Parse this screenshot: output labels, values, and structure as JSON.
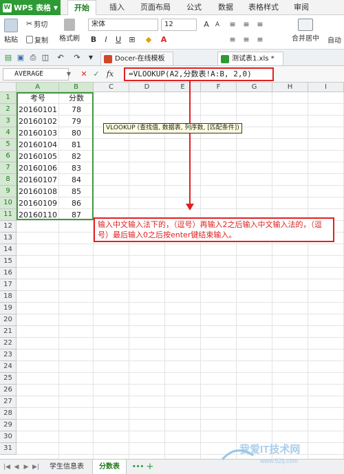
{
  "topbar": {
    "app_name": "WPS 表格",
    "tabs": [
      "开始",
      "插入",
      "页面布局",
      "公式",
      "数据",
      "表格样式",
      "审阅"
    ]
  },
  "ribbon": {
    "paste": "粘贴",
    "cut": "剪切",
    "copy": "复制",
    "format_painter": "格式刷",
    "font_name": "宋体",
    "font_size": "12",
    "merge_center": "合并居中",
    "wrap": "自动"
  },
  "doc_tabs": [
    {
      "label": "Docer-在线模板"
    },
    {
      "label": "测试表1.xls *"
    }
  ],
  "formula_bar": {
    "name_box": "AVERAGE",
    "fx": "fx",
    "formula": "=VLOOKUP(A2,分数表!A:B, 2,0)"
  },
  "grid": {
    "columns": [
      "A",
      "B",
      "C",
      "D",
      "E",
      "F",
      "G",
      "H",
      "I"
    ],
    "rows": [
      "1",
      "2",
      "3",
      "4",
      "5",
      "6",
      "7",
      "8",
      "9",
      "10",
      "11",
      "12",
      "13",
      "14",
      "15",
      "16",
      "17",
      "18",
      "19",
      "20",
      "21",
      "22",
      "23",
      "24",
      "25",
      "26",
      "27",
      "28",
      "29",
      "30",
      "31"
    ],
    "header_row": [
      "考号",
      "分数"
    ],
    "data": [
      [
        "20160101",
        "78"
      ],
      [
        "20160102",
        "79"
      ],
      [
        "20160103",
        "80"
      ],
      [
        "20160104",
        "81"
      ],
      [
        "20160105",
        "82"
      ],
      [
        "20160106",
        "83"
      ],
      [
        "20160107",
        "84"
      ],
      [
        "20160108",
        "85"
      ],
      [
        "20160109",
        "86"
      ],
      [
        "20160110",
        "87"
      ]
    ]
  },
  "tooltip": "VLOOKUP (查找值, 数据表, 列序数, [匹配条件])",
  "note": "输入中文输入法下的，（逗号）再输入2之后输入中文输入法的，（逗号）最后输入0之后按enter键结束输入。",
  "sheet_tabs": [
    "学生信息表",
    "分数表"
  ],
  "watermark": {
    "title": "我爱IT技术网",
    "url": "www.52ij.com"
  },
  "colors": {
    "accent_green": "#2e9a35",
    "annotation_red": "#e02020",
    "tooltip_bg": "#ffffe1"
  }
}
